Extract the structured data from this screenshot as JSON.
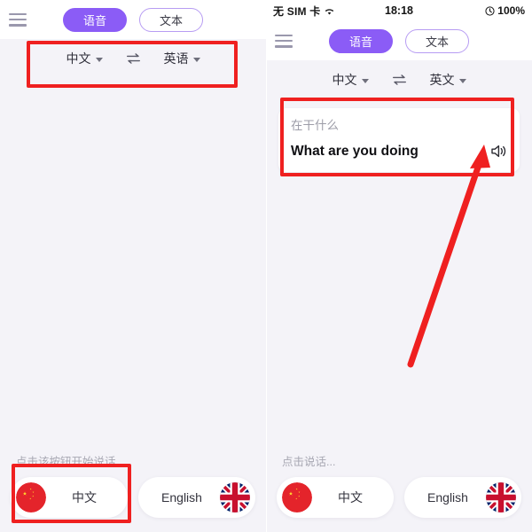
{
  "left_panel": {
    "menu_icon": "hamburger-icon",
    "segmented": {
      "voice_label": "语音",
      "text_label": "文本",
      "active": "语音"
    },
    "language_row": {
      "source_label": "中文",
      "swap_icon": "swap-arrows-icon",
      "target_label": "英语"
    },
    "hint": "点击该按钮开始说话...",
    "mic_buttons": [
      {
        "label": "中文",
        "flag": "cn-flag-icon"
      },
      {
        "label": "English",
        "flag": "uk-flag-icon"
      }
    ]
  },
  "right_panel": {
    "statusbar": {
      "carrier": "无 SIM 卡",
      "wifi_icon": "wifi-icon",
      "time": "18:18",
      "battery_icon": "battery-icon",
      "battery_level": "100%"
    },
    "menu_icon": "hamburger-icon",
    "segmented": {
      "voice_label": "语音",
      "text_label": "文本",
      "active": "语音"
    },
    "language_row": {
      "source_label": "中文",
      "swap_icon": "swap-arrows-icon",
      "target_label": "英文"
    },
    "translation_card": {
      "source_text": "在干什么",
      "translated_text": "What are you doing",
      "speaker_icon": "speaker-icon"
    },
    "hint": "点击说话...",
    "mic_buttons": [
      {
        "label": "中文",
        "flag": "cn-flag-icon"
      },
      {
        "label": "English",
        "flag": "uk-flag-icon"
      }
    ]
  },
  "annotations": {
    "highlight_color": "#ef2020",
    "boxes": [
      {
        "name": "language-row-highlight",
        "panel": "left"
      },
      {
        "name": "mic-button-highlight",
        "panel": "left"
      },
      {
        "name": "translation-card-highlight",
        "panel": "right"
      }
    ],
    "arrow": {
      "name": "pointer-arrow",
      "target": "speaker-icon"
    }
  },
  "theme": {
    "accent": "#8b5cf6",
    "accent_border": "#b79cf3",
    "background": "#f4f3f8",
    "card": "#ffffff"
  }
}
